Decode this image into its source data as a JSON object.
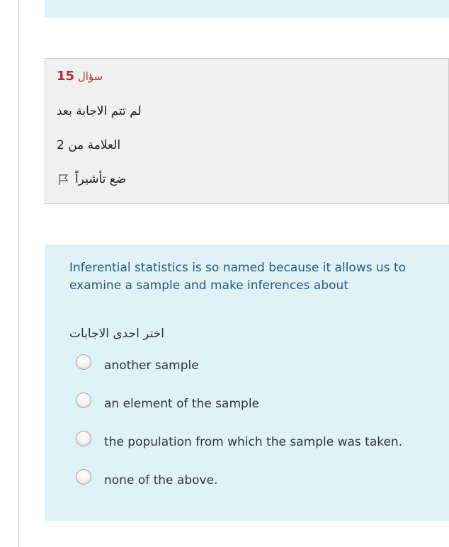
{
  "question": {
    "number_prefix": "سؤال",
    "number": "15",
    "state": "لم تتم الاجابة بعد",
    "grade": "العلامة من 2",
    "flag_label": "ضع تأشيراً",
    "text": "Inferential statistics is so named because it allows us to examine a sample and make inferences about",
    "prompt": "اختر احدى الاجابات",
    "answers": [
      "another sample",
      "an element of the sample",
      "the population from which the sample was taken.",
      "none of the above."
    ]
  },
  "colors": {
    "panel_bg": "#def2f8",
    "info_bg": "#f0f0f0",
    "question_text": "#2a5a7a",
    "number_red": "#c02a2a"
  }
}
